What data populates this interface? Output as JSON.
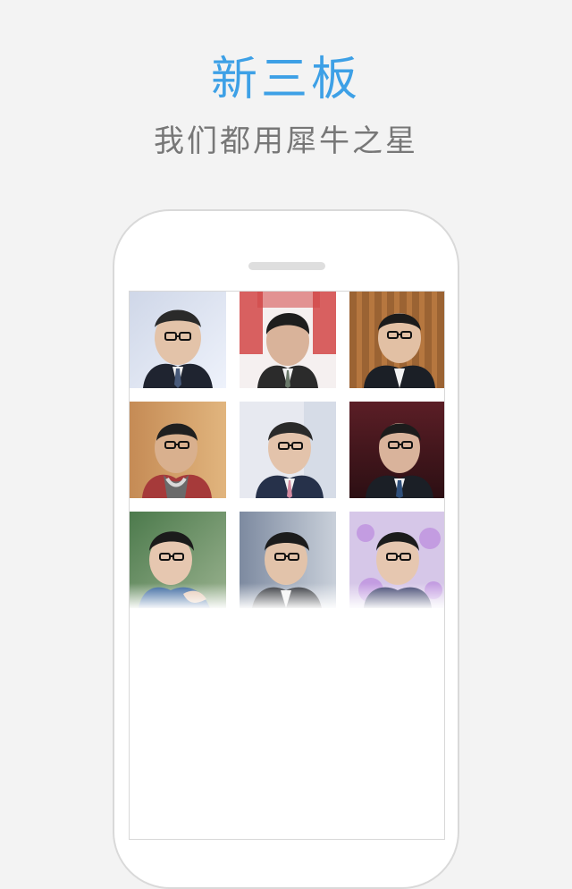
{
  "headline": "新三板",
  "subline": "我们都用犀牛之星",
  "colors": {
    "headline": "#3da0e6",
    "subline": "#777777",
    "background": "#f3f3f3"
  },
  "grid": {
    "items": [
      {
        "name": "profile-1"
      },
      {
        "name": "profile-2"
      },
      {
        "name": "profile-3"
      },
      {
        "name": "profile-4"
      },
      {
        "name": "profile-5"
      },
      {
        "name": "profile-6"
      },
      {
        "name": "profile-7"
      },
      {
        "name": "profile-8"
      },
      {
        "name": "profile-9"
      }
    ]
  }
}
